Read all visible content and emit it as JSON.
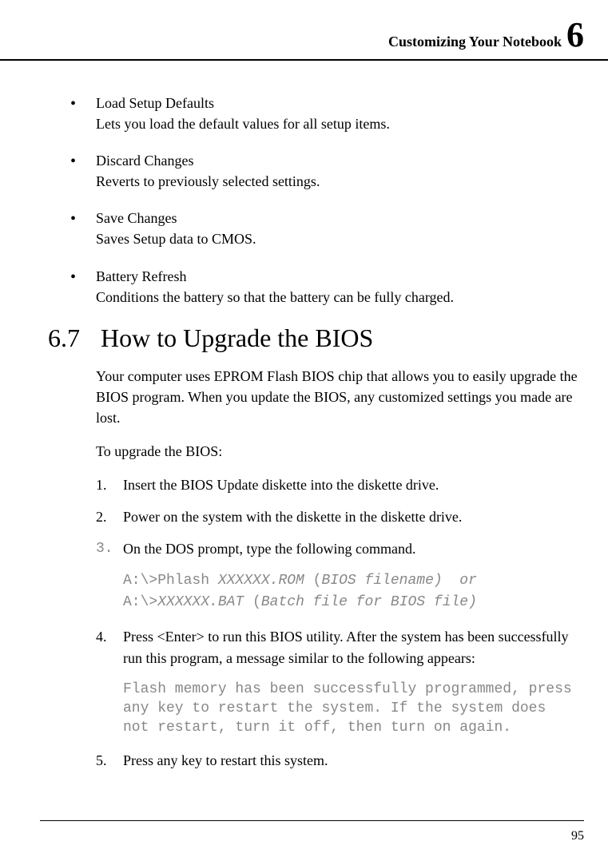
{
  "header": {
    "title": "Customizing Your Notebook",
    "chapter": "6"
  },
  "bullets": [
    {
      "title": "Load Setup Defaults",
      "desc": "Lets you load the default values for all setup items."
    },
    {
      "title": "Discard Changes",
      "desc": "Reverts to previously selected settings."
    },
    {
      "title": "Save Changes",
      "desc": "Saves Setup data to CMOS."
    },
    {
      "title": "Battery Refresh",
      "desc": "Conditions the battery so that the battery can be fully charged."
    }
  ],
  "section": {
    "number": "6.7",
    "title": "How to Upgrade the BIOS"
  },
  "intro": "Your computer uses EPROM Flash BIOS chip that allows you to easily upgrade the BIOS program. When you update the BIOS, any customized settings you made are lost.",
  "lead": "To upgrade the BIOS:",
  "steps": {
    "s1": {
      "marker": "1.",
      "text": "Insert the BIOS Update diskette into the diskette drive."
    },
    "s2": {
      "marker": "2.",
      "text": "Power on the system with the diskette in the diskette drive."
    },
    "s3": {
      "marker": "3.",
      "text": "On the DOS prompt, type the following command."
    },
    "s4": {
      "marker": "4.",
      "text": "Press <Enter> to run this BIOS utility. After the system has been successfully run this program, a message similar to the following appears:"
    },
    "s5": {
      "marker": "5.",
      "text": "Press any key to restart this system."
    }
  },
  "code": {
    "line1a": "A:\\>Phlash ",
    "line1b": "XXXXXX.ROM ",
    "line1c": "(",
    "line1d": "BIOS filename)  or",
    "line2a": "A:\\>",
    "line2b": "XXXXXX.BAT ",
    "line2c": "(",
    "line2d": "Batch file for BIOS file)"
  },
  "message": "Flash memory has been successfully programmed, press any key to restart the system. If the system does not restart, turn it off, then turn on again.",
  "page_number": "95"
}
